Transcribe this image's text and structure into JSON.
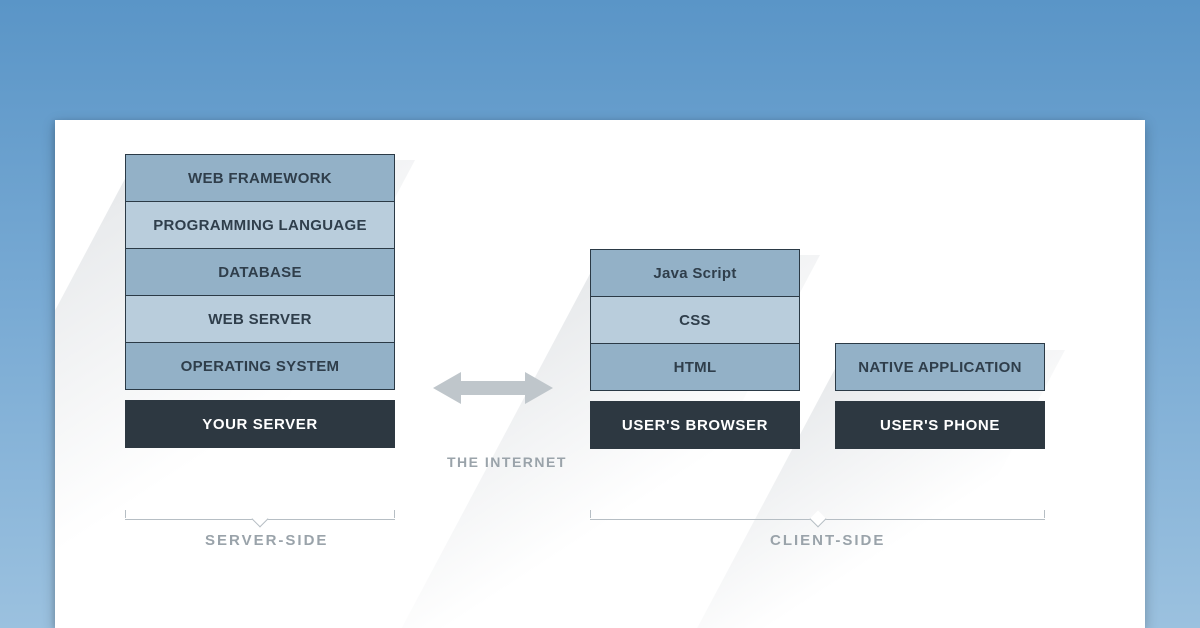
{
  "server_stack": {
    "layers": [
      {
        "label": "WEB FRAMEWORK",
        "shade": "med"
      },
      {
        "label": "PROGRAMMING LANGUAGE",
        "shade": "light"
      },
      {
        "label": "DATABASE",
        "shade": "med"
      },
      {
        "label": "WEB SERVER",
        "shade": "light"
      },
      {
        "label": "OPERATING SYSTEM",
        "shade": "med"
      }
    ],
    "base_label": "YOUR SERVER",
    "group_label": "SERVER-SIDE"
  },
  "browser_stack": {
    "layers": [
      {
        "label": "Java Script",
        "shade": "med"
      },
      {
        "label": "CSS",
        "shade": "light"
      },
      {
        "label": "HTML",
        "shade": "med"
      }
    ],
    "base_label": "USER'S BROWSER"
  },
  "phone_stack": {
    "layers": [
      {
        "label": "NATIVE APPLICATION",
        "shade": "med"
      }
    ],
    "base_label": "USER'S PHONE"
  },
  "client_group_label": "CLIENT-SIDE",
  "internet_label": "THE INTERNET"
}
